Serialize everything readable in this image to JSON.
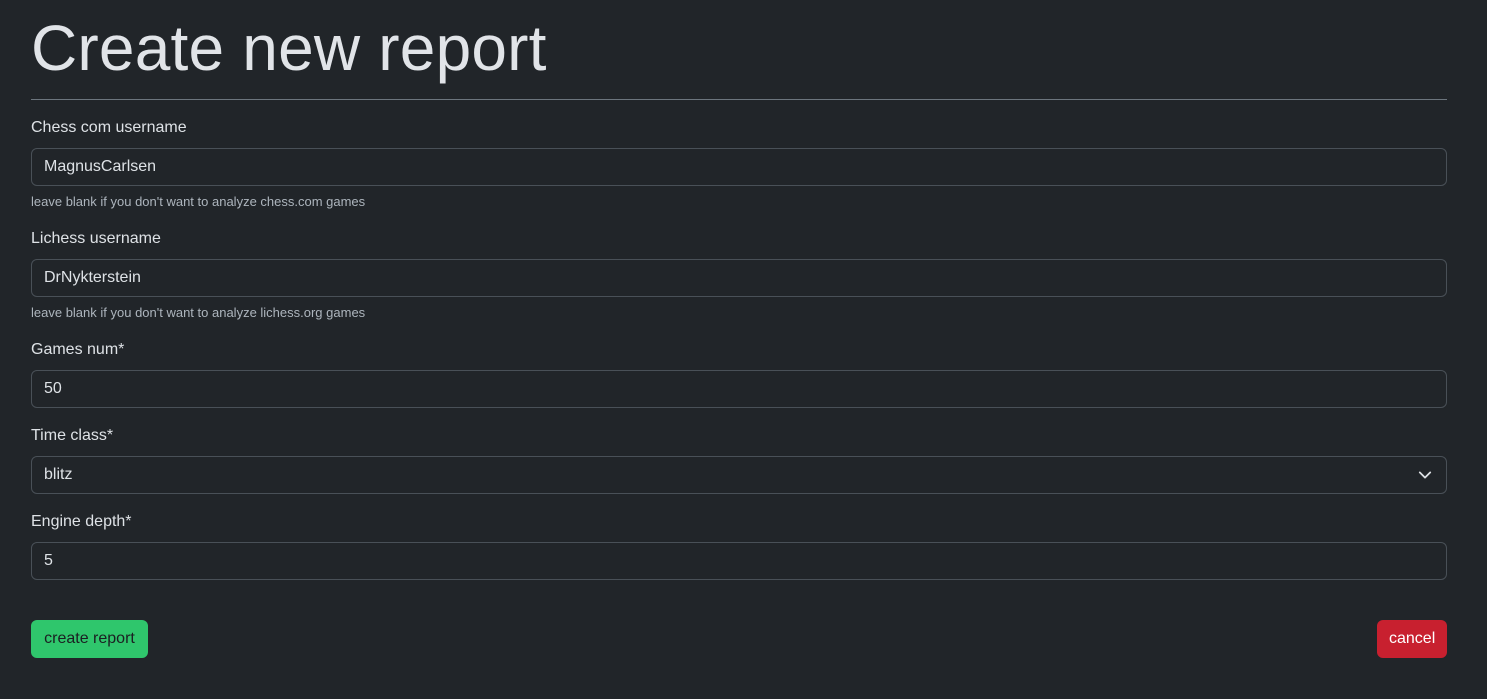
{
  "page": {
    "title": "Create new report"
  },
  "form": {
    "chess_com": {
      "label": "Chess com username",
      "value": "MagnusCarlsen",
      "help": "leave blank if you don't want to analyze chess.com games"
    },
    "lichess": {
      "label": "Lichess username",
      "value": "DrNykterstein",
      "help": "leave blank if you don't want to analyze lichess.org games"
    },
    "games_num": {
      "label": "Games num*",
      "value": "50"
    },
    "time_class": {
      "label": "Time class*",
      "selected": "blitz"
    },
    "engine_depth": {
      "label": "Engine depth*",
      "value": "5"
    }
  },
  "actions": {
    "create_label": "create report",
    "cancel_label": "cancel"
  },
  "colors": {
    "background": "#212529",
    "create_button": "#2fc66c",
    "cancel_button": "#c8202f"
  },
  "icons": {
    "select_arrow": "chevron-down-icon"
  }
}
